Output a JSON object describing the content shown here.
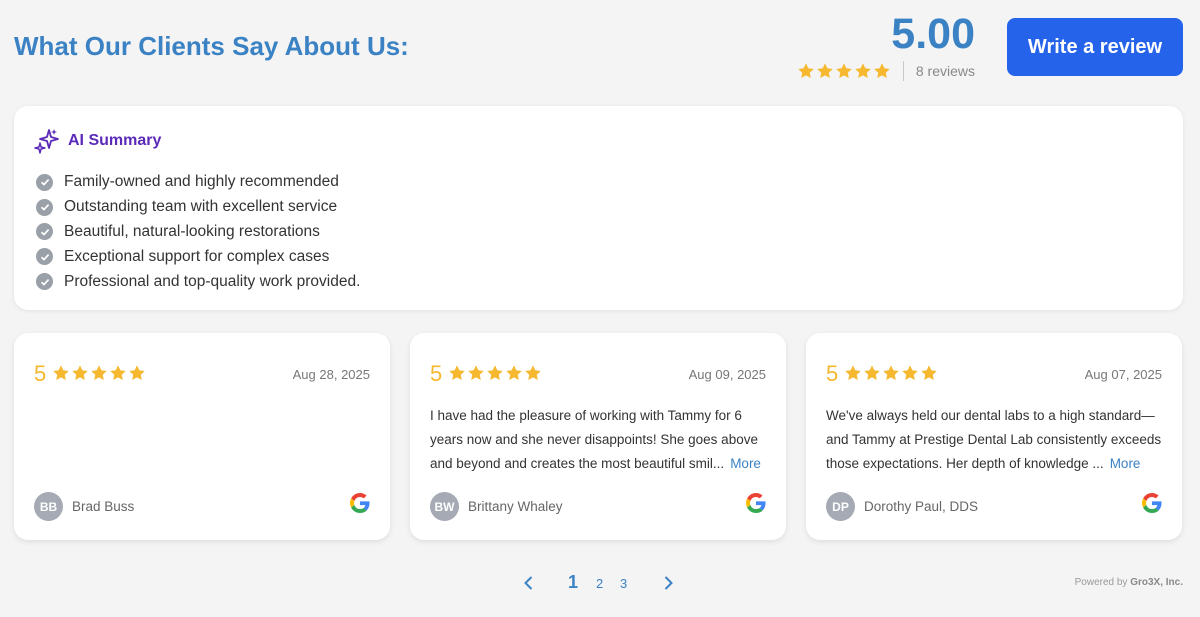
{
  "header": {
    "title": "What Our Clients Say About Us:",
    "rating": "5.00",
    "star_count": 5,
    "reviews_label": "8 reviews",
    "write_review_label": "Write a review"
  },
  "summary": {
    "title": "AI Summary",
    "items": [
      {
        "text": "Family-owned and highly recommended"
      },
      {
        "text": "Outstanding team with excellent service"
      },
      {
        "text": "Beautiful, natural-looking restorations"
      },
      {
        "text": "Exceptional support for complex cases"
      },
      {
        "text": "Professional and top-quality work provided."
      }
    ]
  },
  "reviews": [
    {
      "score": "5",
      "date": "Aug 28, 2025",
      "text": "",
      "more_label": "",
      "initials": "BB",
      "author": "Brad Buss",
      "source_icon": "google-icon"
    },
    {
      "score": "5",
      "date": "Aug 09, 2025",
      "text": "I have had the pleasure of working with Tammy for 6 years now and she never disappoints! She goes above and beyond and creates the most beautiful smil...",
      "more_label": "More",
      "initials": "BW",
      "author": "Brittany Whaley",
      "source_icon": "google-icon"
    },
    {
      "score": "5",
      "date": "Aug 07, 2025",
      "text": "We've always held our dental labs to a high standard—and Tammy at Prestige Dental Lab consistently exceeds those expectations. Her depth of knowledge ...",
      "more_label": "More",
      "initials": "DP",
      "author": "Dorothy Paul, DDS",
      "source_icon": "google-icon"
    }
  ],
  "pagination": {
    "pages": [
      "1",
      "2",
      "3"
    ],
    "current": "1"
  },
  "footer": {
    "powered_prefix": "Powered by",
    "powered_brand": "Gro3X, Inc."
  },
  "colors": {
    "accent": "#3b82c4",
    "button": "#2563eb",
    "star": "#f5b82e",
    "ai_purple": "#5b2ab8",
    "avatar": "#a5aab5"
  }
}
